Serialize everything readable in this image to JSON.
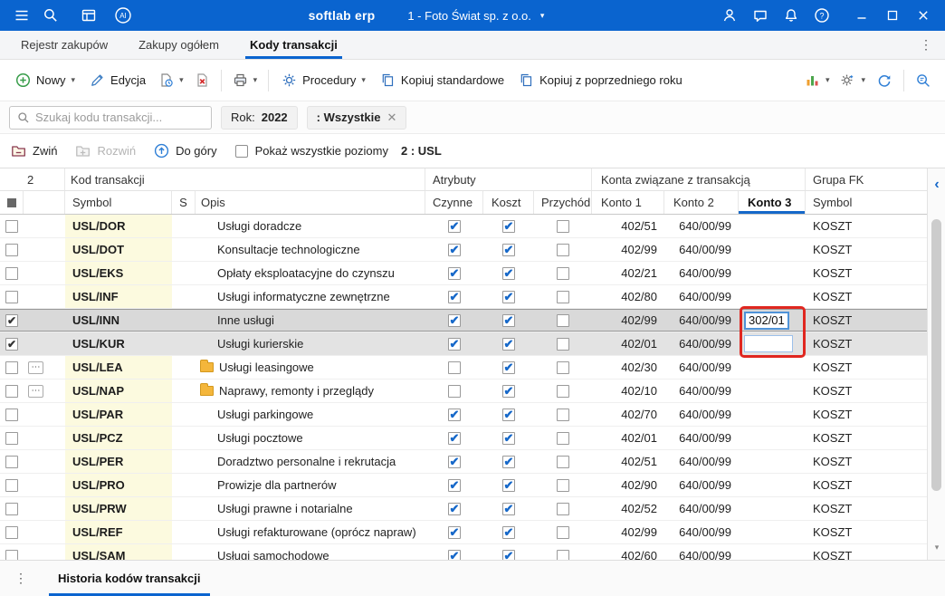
{
  "titlebar": {
    "app_name": "softlab erp",
    "company": "1 - Foto Świat sp. z o.o."
  },
  "tabbar": {
    "tabs": [
      {
        "label": "Rejestr zakupów"
      },
      {
        "label": "Zakupy ogółem"
      },
      {
        "label": "Kody transakcji"
      }
    ]
  },
  "toolbar": {
    "nowy": "Nowy",
    "edycja": "Edycja",
    "procedury": "Procedury",
    "kopiuj_standardowe": "Kopiuj standardowe",
    "kopiuj_poprzedni": "Kopiuj z poprzedniego roku"
  },
  "filterbar": {
    "search_placeholder": "Szukaj kodu transakcji...",
    "rok_label": "Rok:",
    "rok_value": "2022",
    "filter_chip": ": Wszystkie"
  },
  "treebar": {
    "zwin": "Zwiń",
    "rozwin": "Rozwiń",
    "do_gory": "Do góry",
    "pokaz_label": "Pokaż wszystkie poziomy",
    "level_info": "2 : USL"
  },
  "table": {
    "group_header": {
      "level": "2",
      "kod_transakcji": "Kod transakcji",
      "atrybuty": "Atrybuty",
      "konta": "Konta związane z transakcją",
      "grupa_fk": "Grupa FK"
    },
    "columns": {
      "symbol": "Symbol",
      "s": "S",
      "opis": "Opis",
      "czynne": "Czynne",
      "koszt": "Koszt",
      "przychod": "Przychód",
      "konto1": "Konto 1",
      "konto2": "Konto 2",
      "konto3": "Konto 3",
      "grupa_symbol": "Symbol"
    },
    "edit_value": "302/01",
    "rows": [
      {
        "selected": false,
        "expander": false,
        "folder": false,
        "symbol": "USL/DOR",
        "opis": "Usługi doradcze",
        "czynne": true,
        "koszt": true,
        "przychod": false,
        "konto1": "402/51",
        "konto2": "640/00/99",
        "konto3": "",
        "grupa": "KOSZT"
      },
      {
        "selected": false,
        "expander": false,
        "folder": false,
        "symbol": "USL/DOT",
        "opis": "Konsultacje technologiczne",
        "czynne": true,
        "koszt": true,
        "przychod": false,
        "konto1": "402/99",
        "konto2": "640/00/99",
        "konto3": "",
        "grupa": "KOSZT"
      },
      {
        "selected": false,
        "expander": false,
        "folder": false,
        "symbol": "USL/EKS",
        "opis": "Opłaty eksploatacyjne do czynszu",
        "czynne": true,
        "koszt": true,
        "przychod": false,
        "konto1": "402/21",
        "konto2": "640/00/99",
        "konto3": "",
        "grupa": "KOSZT"
      },
      {
        "selected": false,
        "expander": false,
        "folder": false,
        "symbol": "USL/INF",
        "opis": "Usługi informatyczne zewnętrzne",
        "czynne": true,
        "koszt": true,
        "przychod": false,
        "konto1": "402/80",
        "konto2": "640/00/99",
        "konto3": "",
        "grupa": "KOSZT"
      },
      {
        "selected": true,
        "focus": true,
        "editing": true,
        "expander": false,
        "folder": false,
        "symbol": "USL/INN",
        "opis": "Inne usługi",
        "czynne": true,
        "koszt": true,
        "przychod": false,
        "konto1": "402/99",
        "konto2": "640/00/99",
        "konto3": "302/01",
        "grupa": "KOSZT"
      },
      {
        "selected": true,
        "edit_slot": true,
        "expander": false,
        "folder": false,
        "symbol": "USL/KUR",
        "opis": "Usługi kurierskie",
        "czynne": true,
        "koszt": true,
        "przychod": false,
        "konto1": "402/01",
        "konto2": "640/00/99",
        "konto3": "",
        "grupa": "KOSZT"
      },
      {
        "selected": false,
        "expander": true,
        "folder": true,
        "symbol": "USL/LEA",
        "opis": "Usługi leasingowe",
        "czynne": false,
        "koszt": true,
        "przychod": false,
        "konto1": "402/30",
        "konto2": "640/00/99",
        "konto3": "",
        "grupa": "KOSZT"
      },
      {
        "selected": false,
        "expander": true,
        "folder": true,
        "symbol": "USL/NAP",
        "opis": "Naprawy, remonty i przeglądy",
        "czynne": false,
        "koszt": true,
        "przychod": false,
        "konto1": "402/10",
        "konto2": "640/00/99",
        "konto3": "",
        "grupa": "KOSZT"
      },
      {
        "selected": false,
        "expander": false,
        "folder": false,
        "symbol": "USL/PAR",
        "opis": "Usługi parkingowe",
        "czynne": true,
        "koszt": true,
        "przychod": false,
        "konto1": "402/70",
        "konto2": "640/00/99",
        "konto3": "",
        "grupa": "KOSZT"
      },
      {
        "selected": false,
        "expander": false,
        "folder": false,
        "symbol": "USL/PCZ",
        "opis": "Usługi pocztowe",
        "czynne": true,
        "koszt": true,
        "przychod": false,
        "konto1": "402/01",
        "konto2": "640/00/99",
        "konto3": "",
        "grupa": "KOSZT"
      },
      {
        "selected": false,
        "expander": false,
        "folder": false,
        "symbol": "USL/PER",
        "opis": "Doradztwo personalne i rekrutacja",
        "czynne": true,
        "koszt": true,
        "przychod": false,
        "konto1": "402/51",
        "konto2": "640/00/99",
        "konto3": "",
        "grupa": "KOSZT"
      },
      {
        "selected": false,
        "expander": false,
        "folder": false,
        "symbol": "USL/PRO",
        "opis": "Prowizje dla partnerów",
        "czynne": true,
        "koszt": true,
        "przychod": false,
        "konto1": "402/90",
        "konto2": "640/00/99",
        "konto3": "",
        "grupa": "KOSZT"
      },
      {
        "selected": false,
        "expander": false,
        "folder": false,
        "symbol": "USL/PRW",
        "opis": "Usługi prawne i notarialne",
        "czynne": true,
        "koszt": true,
        "przychod": false,
        "konto1": "402/52",
        "konto2": "640/00/99",
        "konto3": "",
        "grupa": "KOSZT"
      },
      {
        "selected": false,
        "expander": false,
        "folder": false,
        "symbol": "USL/REF",
        "opis": "Usługi refakturowane (oprócz napraw)",
        "czynne": true,
        "koszt": true,
        "przychod": false,
        "konto1": "402/99",
        "konto2": "640/00/99",
        "konto3": "",
        "grupa": "KOSZT"
      },
      {
        "selected": false,
        "expander": false,
        "folder": false,
        "symbol": "USL/SAM",
        "opis": "Usługi samochodowe",
        "czynne": true,
        "koszt": true,
        "przychod": false,
        "konto1": "402/60",
        "konto2": "640/00/99",
        "konto3": "",
        "grupa": "KOSZT"
      }
    ]
  },
  "bottombar": {
    "tab": "Historia kodów transakcji"
  }
}
